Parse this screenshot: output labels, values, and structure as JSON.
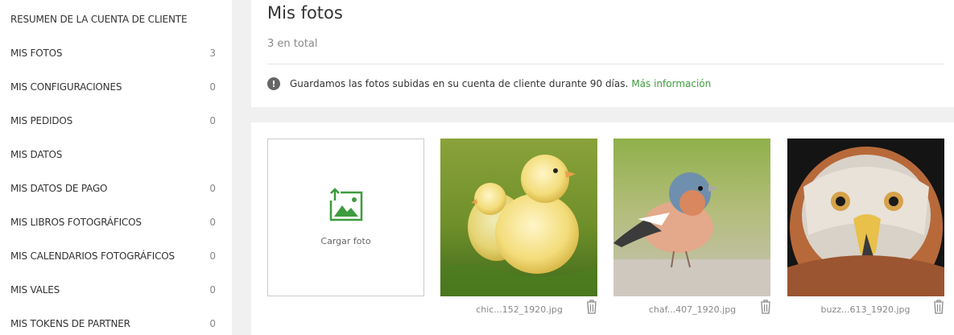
{
  "sidebar": {
    "items": [
      {
        "label": "RESUMEN DE LA CUENTA DE CLIENTE",
        "count": ""
      },
      {
        "label": "MIS FOTOS",
        "count": "3"
      },
      {
        "label": "MIS CONFIGURACIONES",
        "count": "0"
      },
      {
        "label": "MIS PEDIDOS",
        "count": "0"
      },
      {
        "label": "MIS DATOS",
        "count": ""
      },
      {
        "label": "MIS DATOS DE PAGO",
        "count": "0"
      },
      {
        "label": "MIS LIBROS FOTOGRÁFICOS",
        "count": "0"
      },
      {
        "label": "MIS CALENDARIOS FOTOGRÁFICOS",
        "count": "0"
      },
      {
        "label": "MIS VALES",
        "count": "0"
      },
      {
        "label": "MIS TOKENS DE PARTNER",
        "count": "0"
      }
    ]
  },
  "header": {
    "title": "Mis fotos",
    "total": "3 en total",
    "notice_icon": "exclamation-circle-icon",
    "notice_text": "Guardamos las fotos subidas en su cuenta de cliente durante 90 días.",
    "notice_link": "Más información"
  },
  "upload": {
    "label": "Cargar foto",
    "icon": "upload-image-icon"
  },
  "photos": [
    {
      "filename": "chic...152_1920.jpg",
      "subject": "chicks"
    },
    {
      "filename": "chaf...407_1920.jpg",
      "subject": "chaffinch"
    },
    {
      "filename": "buzz...613_1920.jpg",
      "subject": "buzzard"
    }
  ],
  "colors": {
    "accent": "#3e9b3e",
    "background": "#f0f0f0"
  }
}
